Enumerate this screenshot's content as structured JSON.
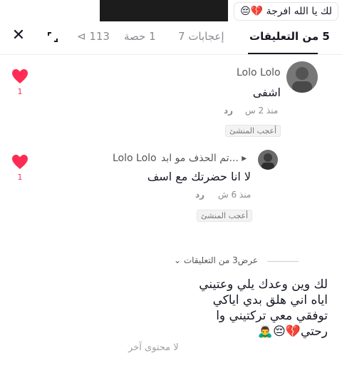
{
  "caption": {
    "text": "لك يا الله افرجة 💔😔"
  },
  "tabs": [
    {
      "label": "5 من التعليقات"
    },
    {
      "label": "إعجابات 7"
    },
    {
      "label": "1 حصة"
    },
    {
      "label": "113 ⊳"
    }
  ],
  "comments": [
    {
      "name": "Lolo Lolo",
      "text": "اشفى",
      "time": "منذ 2 س",
      "reply": "رد",
      "chip": "أعجب المنشئ",
      "likes": "1"
    },
    {
      "name": "Lolo Lolo",
      "reply_to": "▸ ...تم الحذف مو ابد",
      "text": "لا انا حضرتك مع اسف",
      "time": "منذ 6 ش",
      "reply": "رد",
      "chip": "أعجب المنشئ",
      "likes": "1"
    }
  ],
  "show_more": {
    "label": "عرض3 من التعليقات ⌄"
  },
  "overlay": {
    "line1": "لك وين وعدك يلي وعتيني",
    "line2": "اياه اني هلق بدي اياكي",
    "line3": "توفقي معي تركتيني وا",
    "line4": "رحتي💔😔🙇‍♂️"
  },
  "footer": {
    "no_more": "لا محتوى آخر"
  },
  "colors": {
    "like": "#fe2c55",
    "text": "#161823",
    "muted": "#8a8b91"
  }
}
